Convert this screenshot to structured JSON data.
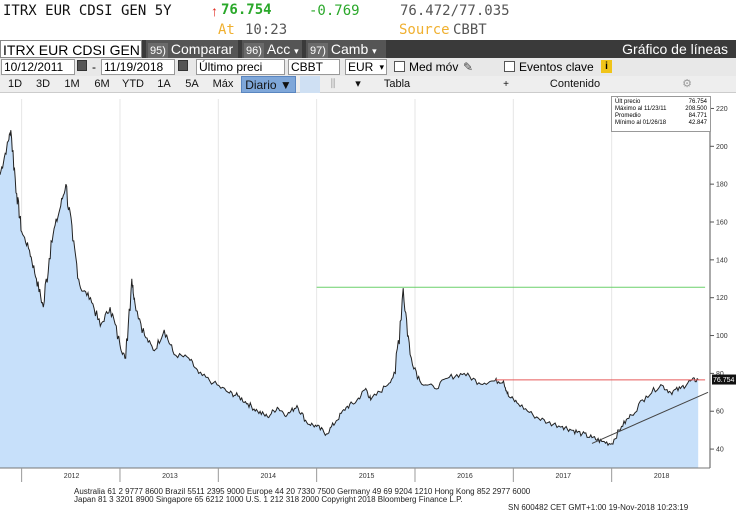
{
  "quote": {
    "ticker": "ITRX EUR CDSI GEN 5Y",
    "arrow": "↑",
    "last": "76.754",
    "change": "-0.769",
    "bid_ask": "76.472/77.035",
    "at_label": "At",
    "time": "10:23",
    "source_label": "Source",
    "source": "CBBT"
  },
  "toolbar": {
    "ticker_field": "ITRX EUR CDSI GEN",
    "compare_key": "95)",
    "compare_label": "Comparar",
    "actions_key": "96)",
    "actions_label": "Acc",
    "change_key": "97)",
    "change_label": "Camb",
    "chart_title": "Gráfico de líneas"
  },
  "options": {
    "start_date": "10/12/2011",
    "date_sep": "-",
    "end_date": "11/19/2018",
    "price_field": "Último preci",
    "source_field": "CBBT",
    "currency": "EUR",
    "moving_avg_label": "Med móv",
    "key_events_label": "Eventos clave"
  },
  "periods": {
    "items": [
      "1D",
      "3D",
      "1M",
      "6M",
      "YTD",
      "1A",
      "5A",
      "Máx"
    ],
    "daily": "Diario ▼",
    "table": "Tabla",
    "content": "Contenido"
  },
  "legend": {
    "rows": [
      {
        "label": "Últ precio",
        "value": "76.754"
      },
      {
        "label": "Máximo al 11/23/11",
        "value": "208.500"
      },
      {
        "label": "Promedio",
        "value": "84.771"
      },
      {
        "label": "Mínimo al 01/26/18",
        "value": "42.847"
      }
    ]
  },
  "chart_data": {
    "type": "area",
    "x_labels": [
      "2012",
      "2013",
      "2014",
      "2015",
      "2016",
      "2017",
      "2018"
    ],
    "y_ticks": [
      40,
      60,
      80,
      100,
      120,
      140,
      160,
      180,
      200,
      220
    ],
    "ylim": [
      30,
      225
    ],
    "last_value_tag": "76.754",
    "series": [
      {
        "values": [
          [
            2011.78,
            185
          ],
          [
            2011.85,
            200
          ],
          [
            2011.89,
            208.5
          ],
          [
            2011.95,
            175
          ],
          [
            2012.0,
            155
          ],
          [
            2012.08,
            145
          ],
          [
            2012.15,
            130
          ],
          [
            2012.22,
            115
          ],
          [
            2012.3,
            150
          ],
          [
            2012.38,
            165
          ],
          [
            2012.45,
            180
          ],
          [
            2012.52,
            150
          ],
          [
            2012.6,
            125
          ],
          [
            2012.7,
            120
          ],
          [
            2012.8,
            105
          ],
          [
            2012.9,
            115
          ],
          [
            2013.0,
            95
          ],
          [
            2013.05,
            88
          ],
          [
            2013.12,
            130
          ],
          [
            2013.15,
            118
          ],
          [
            2013.25,
            100
          ],
          [
            2013.35,
            92
          ],
          [
            2013.45,
            103
          ],
          [
            2013.55,
            90
          ],
          [
            2013.7,
            88
          ],
          [
            2013.8,
            80
          ],
          [
            2013.95,
            75
          ],
          [
            2014.1,
            70
          ],
          [
            2014.2,
            68
          ],
          [
            2014.3,
            64
          ],
          [
            2014.4,
            60
          ],
          [
            2014.5,
            57
          ],
          [
            2014.6,
            62
          ],
          [
            2014.7,
            58
          ],
          [
            2014.8,
            63
          ],
          [
            2014.9,
            54
          ],
          [
            2015.0,
            52
          ],
          [
            2015.1,
            48
          ],
          [
            2015.2,
            55
          ],
          [
            2015.3,
            62
          ],
          [
            2015.4,
            65
          ],
          [
            2015.5,
            72
          ],
          [
            2015.55,
            66
          ],
          [
            2015.7,
            73
          ],
          [
            2015.8,
            80
          ],
          [
            2015.88,
            125
          ],
          [
            2015.95,
            90
          ],
          [
            2016.05,
            76
          ],
          [
            2016.2,
            72
          ],
          [
            2016.35,
            78
          ],
          [
            2016.5,
            80
          ],
          [
            2016.65,
            75
          ],
          [
            2016.8,
            76
          ],
          [
            2016.9,
            76
          ],
          [
            2016.95,
            68
          ],
          [
            2017.05,
            64
          ],
          [
            2017.2,
            58
          ],
          [
            2017.35,
            54
          ],
          [
            2017.5,
            52
          ],
          [
            2017.6,
            50
          ],
          [
            2017.7,
            48
          ],
          [
            2017.8,
            46
          ],
          [
            2017.9,
            44
          ],
          [
            2018.0,
            42.8
          ],
          [
            2018.1,
            52
          ],
          [
            2018.2,
            58
          ],
          [
            2018.35,
            68
          ],
          [
            2018.5,
            74
          ],
          [
            2018.6,
            70
          ],
          [
            2018.7,
            72
          ],
          [
            2018.8,
            76
          ],
          [
            2018.88,
            76.75
          ]
        ]
      }
    ],
    "reference_lines": [
      {
        "y": 125.5,
        "from": 2015.0,
        "to": 2018.95,
        "color": "#6bd06b"
      },
      {
        "y": 76.6,
        "from": 2016.82,
        "to": 2018.95,
        "color": "#e85a5a"
      }
    ],
    "trend_line": {
      "from": [
        2017.8,
        43
      ],
      "to": [
        2018.98,
        70
      ],
      "color": "#444444"
    },
    "fill_color": "#c7e0fa",
    "line_color": "#222222"
  },
  "footer": {
    "line1": "Australia 61 2 9777 8600 Brazil 5511 2395 9000 Europe 44 20 7330 7500 Germany 49 69 9204 1210 Hong Kong 852 2977 6000",
    "line2": "Japan 81 3 3201 8900          Singapore 65 6212 1000          U.S. 1 212 318 2000          Copyright 2018 Bloomberg Finance L.P.",
    "line3": "SN 600482 CET  GMT+1:00 19-Nov-2018 10:23:19"
  }
}
